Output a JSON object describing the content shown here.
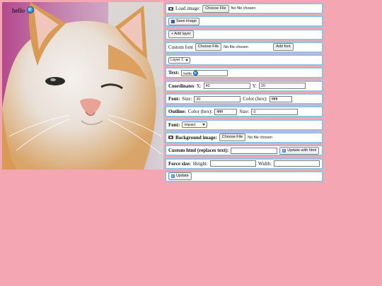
{
  "canvas": {
    "overlay_text": "hello",
    "overlay_globe": "globe-icon"
  },
  "panels": {
    "load_image": {
      "icon": "image-icon",
      "label": "Load image:",
      "button": "Choose File",
      "status": "No file chosen"
    },
    "save_image": {
      "icon": "save-icon",
      "button": "Save image"
    },
    "add_layer": {
      "button": "+ Add layer"
    },
    "custom_font": {
      "label": "Custom font",
      "button": "Choose File",
      "status": "No file chosen",
      "add_button": "Add font"
    },
    "layer_select": {
      "value": "Layer 1"
    },
    "text": {
      "label": "Text:",
      "value": "hello"
    },
    "coordinates": {
      "label": "Coordinates",
      "x_label": "X:",
      "x_value": "40",
      "y_label": "Y:",
      "y_value": "20"
    },
    "font_size": {
      "label": "Font:",
      "size_label": "Size:",
      "size_value": "20",
      "color_label": "Color (hex):",
      "color_value": "ffffff"
    },
    "outline": {
      "label": "Outline:",
      "color_label": "Color (hex):",
      "color_value": "ffffff",
      "size_label": "Size:",
      "size_value": "0"
    },
    "font_family": {
      "label": "Font:",
      "value": "impact"
    },
    "background_image": {
      "icon": "image-icon",
      "label": "Background image:",
      "button": "Choose File",
      "status": "No file chosen"
    },
    "custom_html": {
      "label": "Custom html (replaces text):",
      "value": "",
      "button": "Update with html"
    },
    "force_size": {
      "label": "Force size:",
      "height_label": "Height:",
      "height_value": "",
      "width_label": "Width:",
      "width_value": ""
    },
    "update": {
      "button": "Update"
    }
  }
}
